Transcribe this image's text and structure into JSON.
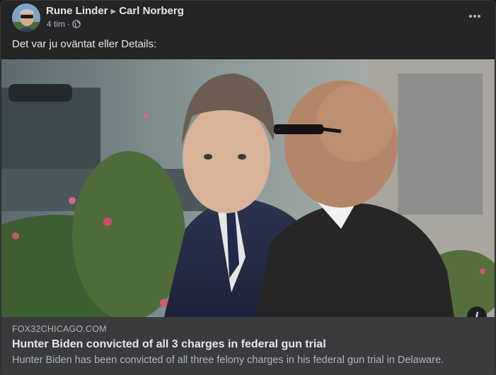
{
  "post": {
    "author": "Rune Linder",
    "recipient": "Carl Norberg",
    "time": "4 tim",
    "separator": "·",
    "audience_icon": "globe-icon",
    "more_icon": "more-options-icon",
    "text": "Det var ju oväntat eller Details:"
  },
  "link_preview": {
    "domain": "FOX32CHICAGO.COM",
    "title": "Hunter Biden convicted of all 3 charges in federal gun trial",
    "description": "Hunter Biden has been convicted of all three felony charges in his federal gun trial in Delaware.",
    "info_icon": "info-icon",
    "info_glyph": "i"
  },
  "colors": {
    "card_bg": "#242526",
    "link_bg": "#3a3b3c",
    "primary_text": "#e4e6eb",
    "secondary_text": "#b0b3b8"
  }
}
